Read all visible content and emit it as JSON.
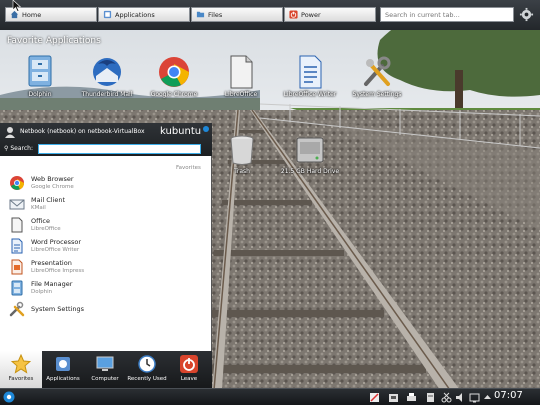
{
  "top_panel": {
    "tabs": [
      {
        "label": "Home",
        "icon": "home-icon"
      },
      {
        "label": "Applications",
        "icon": "applications-icon"
      },
      {
        "label": "Files",
        "icon": "folder-icon"
      },
      {
        "label": "Power",
        "icon": "power-icon"
      }
    ],
    "search_placeholder": "Search in current tab..."
  },
  "favorites": {
    "title": "Favorite Applications",
    "apps": [
      {
        "label": "Dolphin",
        "icon": "dolphin-icon"
      },
      {
        "label": "Thunderbird Mail",
        "icon": "thunderbird-icon"
      },
      {
        "label": "Google Chrome",
        "icon": "chrome-icon"
      },
      {
        "label": "LibreOffice",
        "icon": "libreoffice-icon"
      },
      {
        "label": "LibreOffice Writer",
        "icon": "writer-icon"
      },
      {
        "label": "System Settings",
        "icon": "settings-icon"
      }
    ]
  },
  "desktop": {
    "trash_label": "Trash",
    "disk_label": "21.5 GB Hard Drive"
  },
  "menu": {
    "user_line": "Netbook (netbook) on netbook-VirtualBox",
    "brand": "kubuntu",
    "search_label": "Search:",
    "search_value": "",
    "section_label": "Favorites",
    "items": [
      {
        "title": "Web Browser",
        "subtitle": "Google Chrome",
        "icon": "chrome-icon"
      },
      {
        "title": "Mail Client",
        "subtitle": "KMail",
        "icon": "mail-icon"
      },
      {
        "title": "Office",
        "subtitle": "LibreOffice",
        "icon": "libreoffice-icon"
      },
      {
        "title": "Word Processor",
        "subtitle": "LibreOffice Writer",
        "icon": "writer-icon"
      },
      {
        "title": "Presentation",
        "subtitle": "LibreOffice Impress",
        "icon": "impress-icon"
      },
      {
        "title": "File Manager",
        "subtitle": "Dolphin",
        "icon": "dolphin-icon"
      },
      {
        "title": "System Settings",
        "subtitle": "",
        "icon": "settings-icon"
      }
    ],
    "tabs": [
      {
        "label": "Favorites",
        "icon": "star-icon",
        "active": true
      },
      {
        "label": "Applications",
        "icon": "applications-icon",
        "active": false
      },
      {
        "label": "Computer",
        "icon": "computer-icon",
        "active": false
      },
      {
        "label": "Recently Used",
        "icon": "clock-icon",
        "active": false
      },
      {
        "label": "Leave",
        "icon": "power-icon",
        "active": false
      }
    ]
  },
  "bottom_panel": {
    "clock": "07:07"
  },
  "colors": {
    "accent": "#3daee9",
    "panel": "#23272b"
  }
}
